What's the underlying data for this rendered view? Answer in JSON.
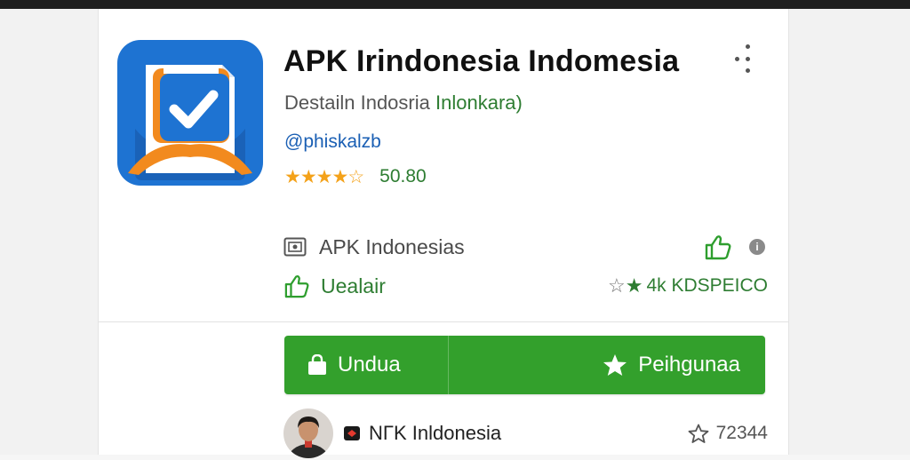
{
  "app": {
    "title": "APK Irindonesia Indomesia",
    "developer_prefix": "Destailn Indosria",
    "developer_accent": "Inlonkara)",
    "handle": "@phiskalzb",
    "rating_stars": 4,
    "rating_max": 5,
    "rating_value": "50.80"
  },
  "info": {
    "publisher_label": "APK Indonesias",
    "update_label": "Uealair",
    "downloads_label": "4k KDSPEIСO"
  },
  "actions": {
    "download_label": "Undua",
    "review_label": "Peihgunaa"
  },
  "author": {
    "name": "NΓK Inldonesia",
    "favorite_count": "72344"
  },
  "colors": {
    "accent_green": "#33a02c",
    "text_green": "#2e7d32",
    "star_orange": "#f4a21a",
    "icon_blue": "#1e73d2",
    "icon_orange": "#f28a1e"
  },
  "icons": {
    "menu": "more-vertical-icon",
    "publisher": "image-icon",
    "like": "thumbs-up-icon",
    "info": "info-icon",
    "download": "shopping-bag-icon",
    "review": "star-icon",
    "favorite": "star-outline-icon"
  }
}
